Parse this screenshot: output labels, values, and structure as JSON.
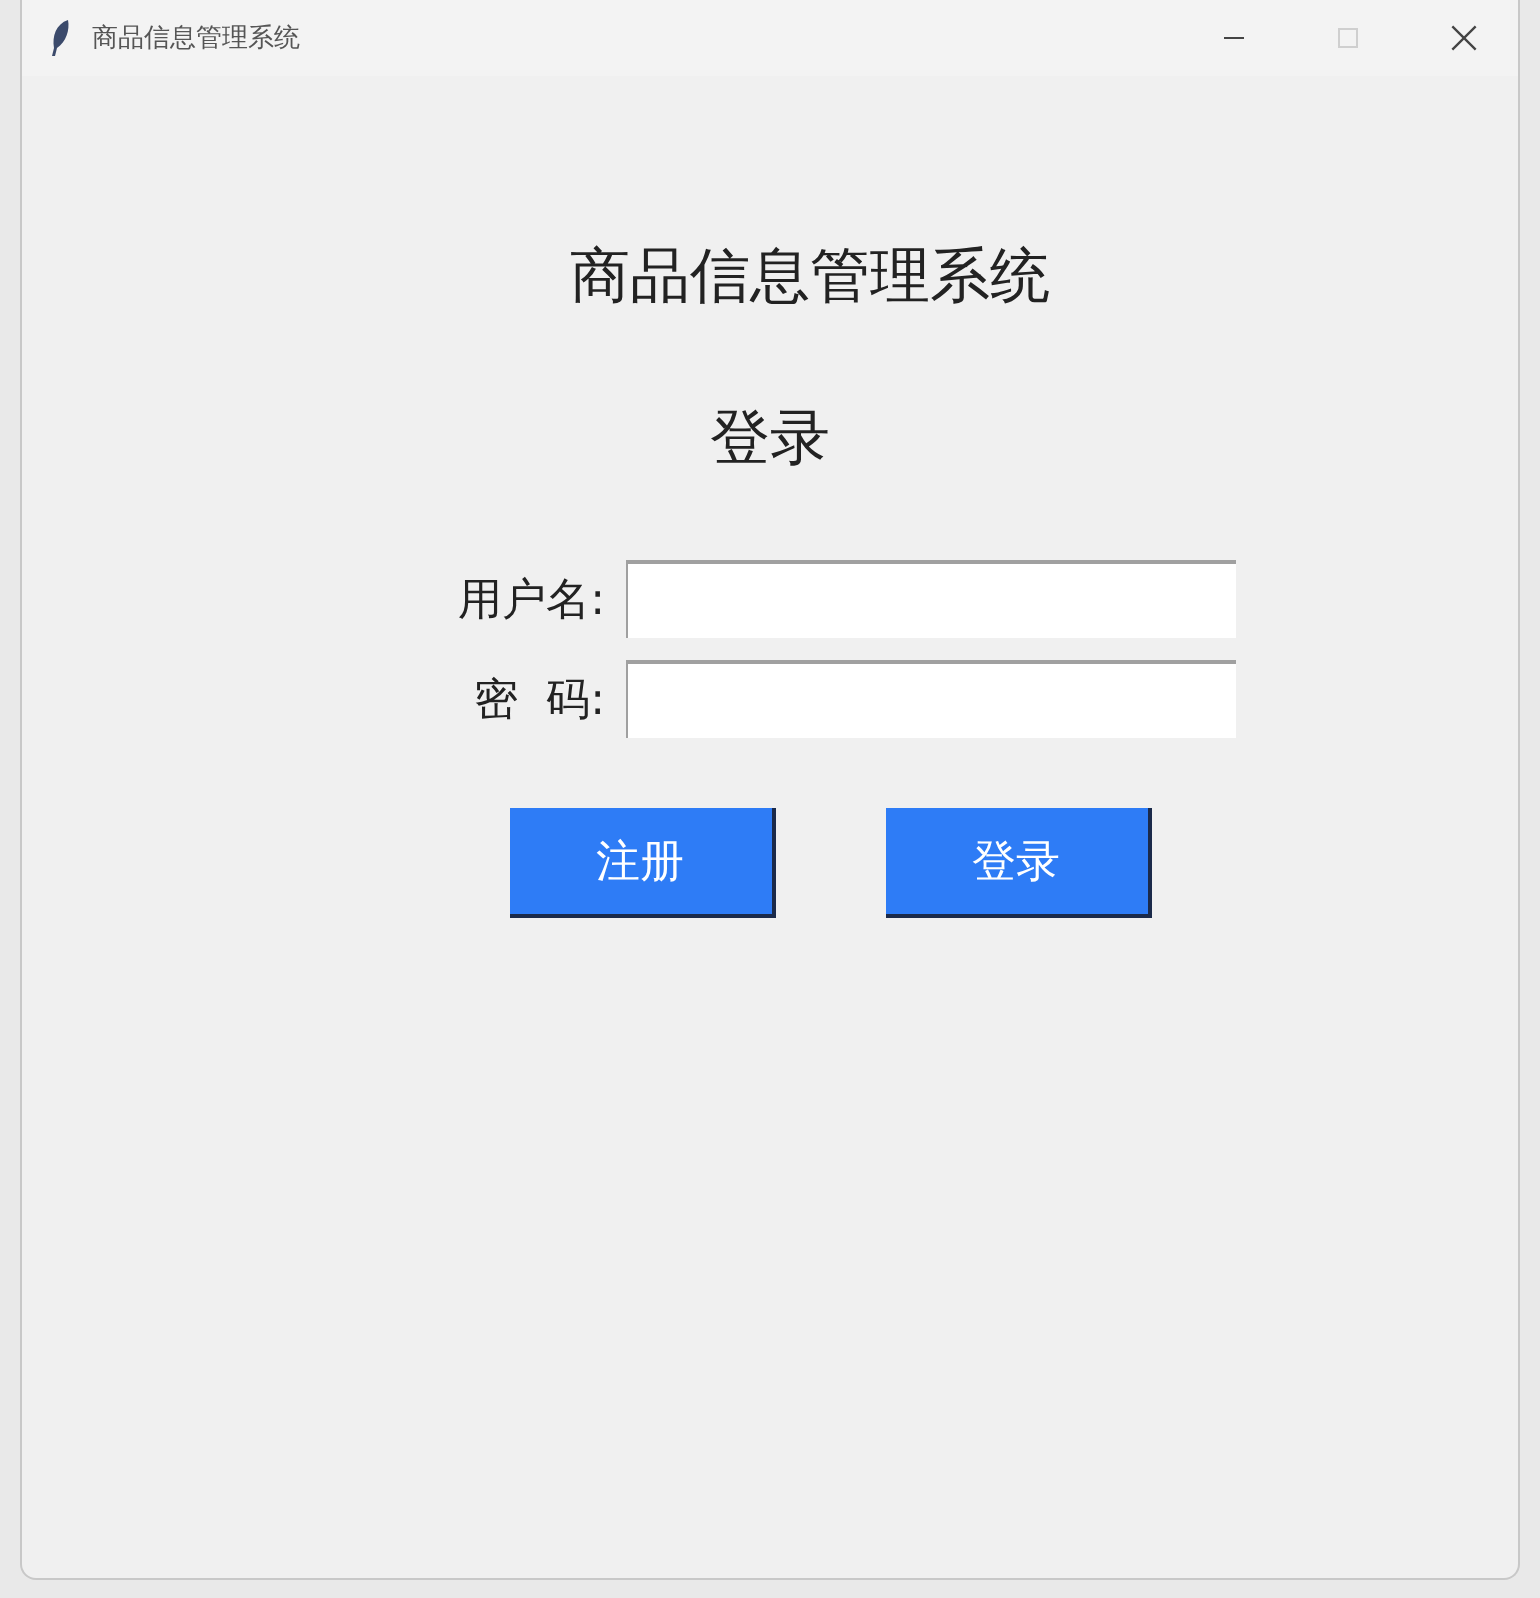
{
  "window": {
    "title": "商品信息管理系统",
    "maximize_enabled": false
  },
  "heading": "商品信息管理系统",
  "subheading": "登录",
  "fields": [
    {
      "label": "用户名:"
    },
    {
      "label": "密  码:"
    }
  ],
  "buttons": [
    "注册",
    "登录"
  ]
}
